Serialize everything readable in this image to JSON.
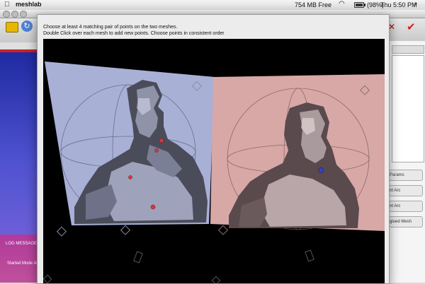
{
  "menubar": {
    "apple_glyph": "",
    "app_name": "meshlab",
    "memory": "754 MB Free",
    "battery": "(98%)",
    "battery_level": 0.98,
    "clock": "Thu 5:50 PM",
    "icons": [
      "apple-icon",
      "wifi-icon",
      "battery-icon",
      "spotlight-icon"
    ]
  },
  "background_window": {
    "toolbar_icons": [
      "open-folder-icon",
      "reload-icon",
      "meshlab-logo-icon",
      "close-icon"
    ],
    "log": {
      "title": "LOG MESSAGES",
      "line": "Started Mode Ali"
    },
    "right_panel": {
      "buttons": [
        "Params",
        "nt Arc",
        "nt Arc",
        "glued Mesh"
      ]
    }
  },
  "dialog": {
    "instruction_1": "Choose at least 4 matching pair of points on the two meshes.",
    "instruction_2": "Double Click over each mesh to add new points. Choose points in consistent order",
    "left_mesh": {
      "background": "#a9b0d6",
      "picked_points": 4,
      "point_color": "#e0343a"
    },
    "right_mesh": {
      "background": "#d7a8a6",
      "picked_points": 1,
      "point_color": "#3a3fd0"
    }
  }
}
